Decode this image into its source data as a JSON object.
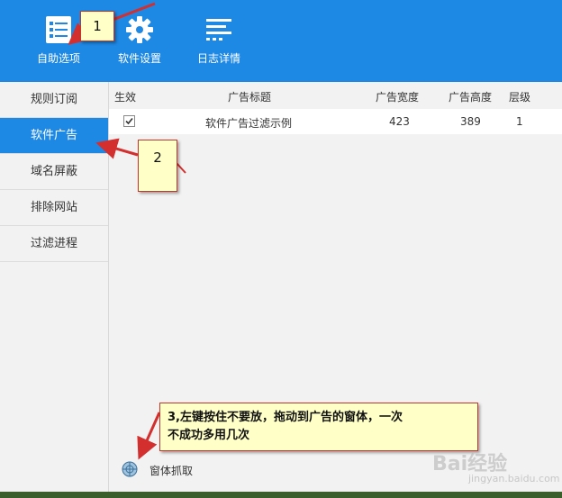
{
  "toolbar": {
    "items": [
      {
        "label": "自助选项",
        "icon": "checklist-icon"
      },
      {
        "label": "软件设置",
        "icon": "gear-icon"
      },
      {
        "label": "日志详情",
        "icon": "log-lines-icon"
      }
    ]
  },
  "sidebar": {
    "items": [
      {
        "label": "规则订阅",
        "active": false
      },
      {
        "label": "软件广告",
        "active": true
      },
      {
        "label": "域名屏蔽",
        "active": false
      },
      {
        "label": "排除网站",
        "active": false
      },
      {
        "label": "过滤进程",
        "active": false
      }
    ]
  },
  "table": {
    "columns": [
      "生效",
      "广告标题",
      "广告宽度",
      "广告高度",
      "层级"
    ],
    "rows": [
      {
        "enabled": true,
        "title": "软件广告过滤示例",
        "width": "423",
        "height": "389",
        "level": "1"
      }
    ]
  },
  "grab": {
    "label": "窗体抓取",
    "icon": "crosshair-target-icon"
  },
  "callouts": {
    "one": "1",
    "two": "2",
    "three_line1": "3,左键按住不要放，拖动到广告的窗体，一次",
    "three_line2": "不成功多用几次"
  },
  "watermark": {
    "brand": "Bai经验",
    "sub": "jingyan.baidu.com"
  },
  "colors": {
    "accent": "#1e88e5",
    "callout_bg": "#ffffc8",
    "arrow": "#d32f2f"
  }
}
